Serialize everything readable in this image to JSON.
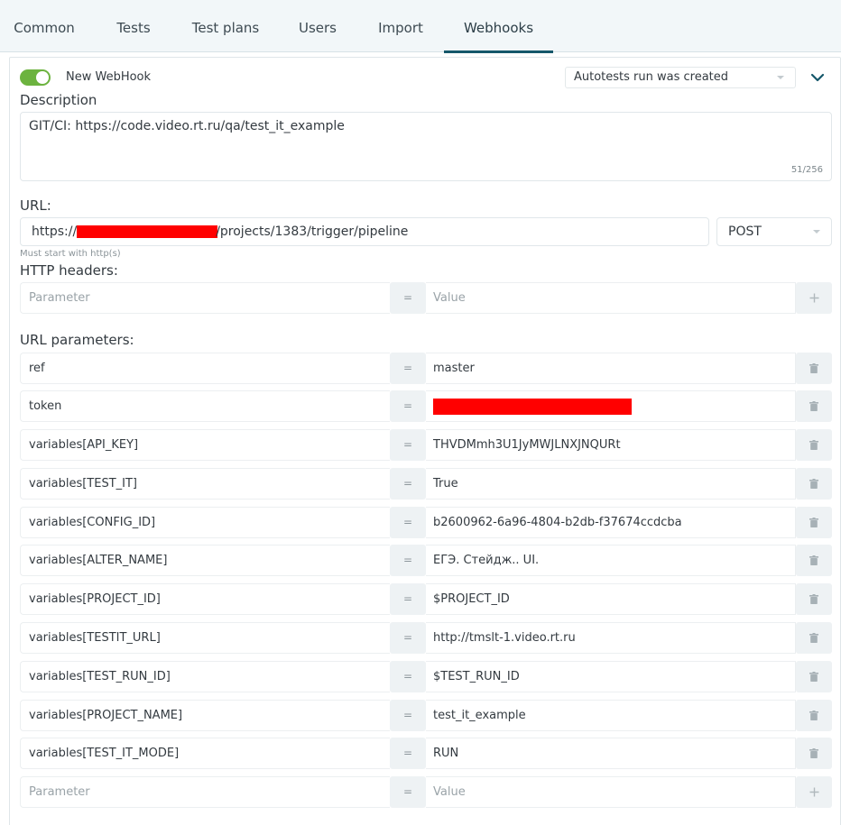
{
  "tabs": [
    {
      "label": "Common"
    },
    {
      "label": "Tests"
    },
    {
      "label": "Test plans"
    },
    {
      "label": "Users"
    },
    {
      "label": "Import"
    },
    {
      "label": "Webhooks",
      "active": true
    }
  ],
  "webhook": {
    "enabled": true,
    "name": "New WebHook",
    "event": "Autotests run was created",
    "description_label": "Description",
    "description": "GIT/CI: https://code.video.rt.ru/qa/test_it_example",
    "description_count": "51/256",
    "url_label": "URL:",
    "url_prefix": "https://",
    "url_suffix": "/projects/1383/trigger/pipeline",
    "method": "POST",
    "url_hint": "Must start with http(s)",
    "headers_label": "HTTP headers:",
    "params_label": "URL parameters:"
  },
  "placeholders": {
    "parameter": "Parameter",
    "value": "Value"
  },
  "eq_sign": "=",
  "url_params": [
    {
      "name": "ref",
      "value": "master"
    },
    {
      "name": "token",
      "value": ""
    },
    {
      "name": "variables[API_KEY]",
      "value": "THVDMmh3U1JyMWJLNXJNQURt"
    },
    {
      "name": "variables[TEST_IT]",
      "value": "True"
    },
    {
      "name": "variables[CONFIG_ID]",
      "value": "b2600962-6a96-4804-b2db-f37674ccdcba"
    },
    {
      "name": "variables[ALTER_NAME]",
      "value": "ЕГЭ. Стейдж.. UI."
    },
    {
      "name": "variables[PROJECT_ID]",
      "value": "$PROJECT_ID"
    },
    {
      "name": "variables[TESTIT_URL]",
      "value": "http://tmslt-1.video.rt.ru"
    },
    {
      "name": "variables[TEST_RUN_ID]",
      "value": "$TEST_RUN_ID"
    },
    {
      "name": "variables[PROJECT_NAME]",
      "value": "test_it_example"
    },
    {
      "name": "variables[TEST_IT_MODE]",
      "value": "RUN"
    }
  ],
  "colors": {
    "accent": "#15576a",
    "toggle_on": "#6cb33f",
    "redaction": "#ff0000"
  }
}
